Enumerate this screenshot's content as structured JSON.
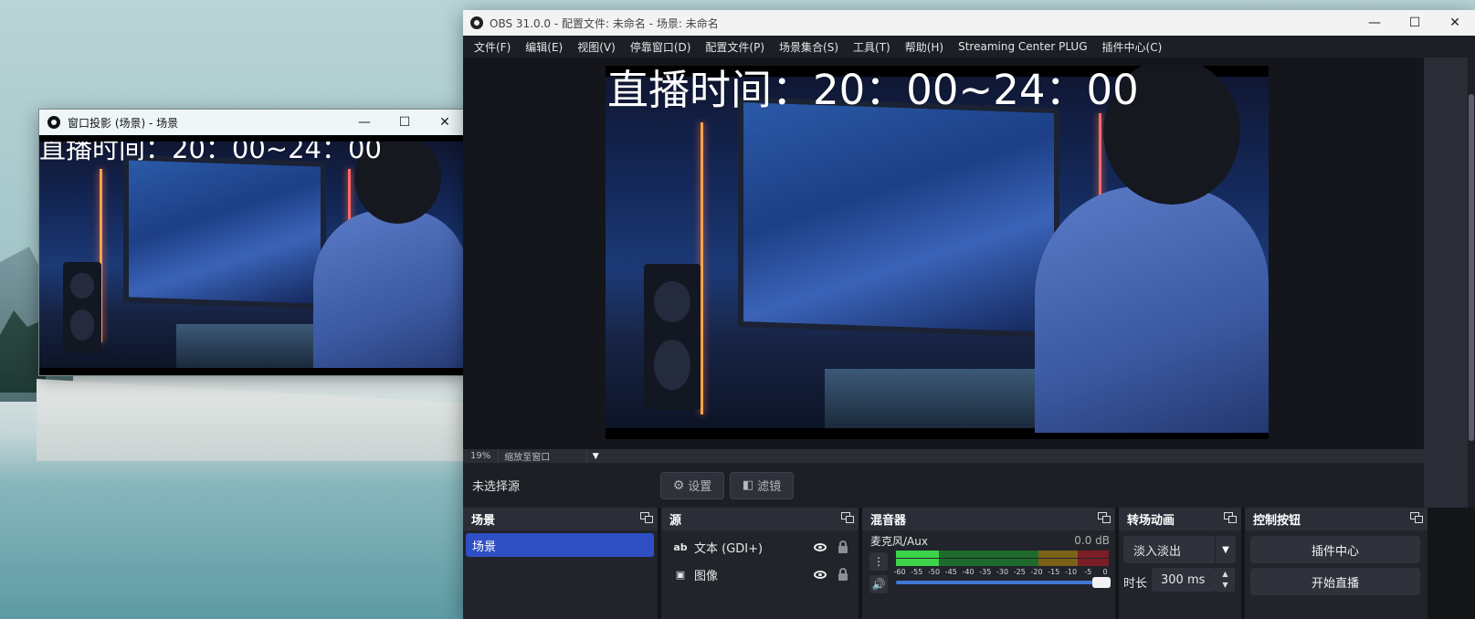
{
  "projector": {
    "title": "窗口投影 (场景) - 场景",
    "overlay_text": "直播时间：20：00~24：00"
  },
  "obs": {
    "title": "OBS 31.0.0 - 配置文件: 未命名 - 场景: 未命名",
    "menu": [
      "文件(F)",
      "编辑(E)",
      "视图(V)",
      "停靠窗口(D)",
      "配置文件(P)",
      "场景集合(S)",
      "工具(T)",
      "帮助(H)",
      "Streaming Center PLUG",
      "插件中心(C)"
    ],
    "preview_overlay_text": "直播时间：20：00~24：00",
    "zoom_percent": "19%",
    "zoom_mode": "缩放至窗口",
    "no_source_selected": "未选择源",
    "settings_button": "设置",
    "filters_button": "滤镜"
  },
  "docks": {
    "scenes": {
      "title": "场景",
      "items": [
        "场景"
      ]
    },
    "sources": {
      "title": "源",
      "items": [
        {
          "icon": "ab",
          "icon_name": "text-source-icon",
          "label": "文本 (GDI+)"
        },
        {
          "icon": "▣",
          "icon_name": "image-source-icon",
          "label": "图像"
        }
      ]
    },
    "mixer": {
      "title": "混音器",
      "channel": "麦克风/Aux",
      "db": "0.0 dB",
      "level_fraction": 0.3,
      "ticks": [
        "-60",
        "-55",
        "-50",
        "-45",
        "-40",
        "-35",
        "-30",
        "-25",
        "-20",
        "-15",
        "-10",
        "-5",
        "0"
      ]
    },
    "transitions": {
      "title": "转场动画",
      "selected": "淡入淡出",
      "duration_label": "时长",
      "duration_value": "300 ms"
    },
    "controls": {
      "title": "控制按钮",
      "buttons": [
        "插件中心",
        "开始直播"
      ]
    }
  },
  "colors": {
    "accent_blue": "#2f4fc4",
    "obs_bg": "#1d1f26",
    "meter_green": "#3cd34a"
  }
}
